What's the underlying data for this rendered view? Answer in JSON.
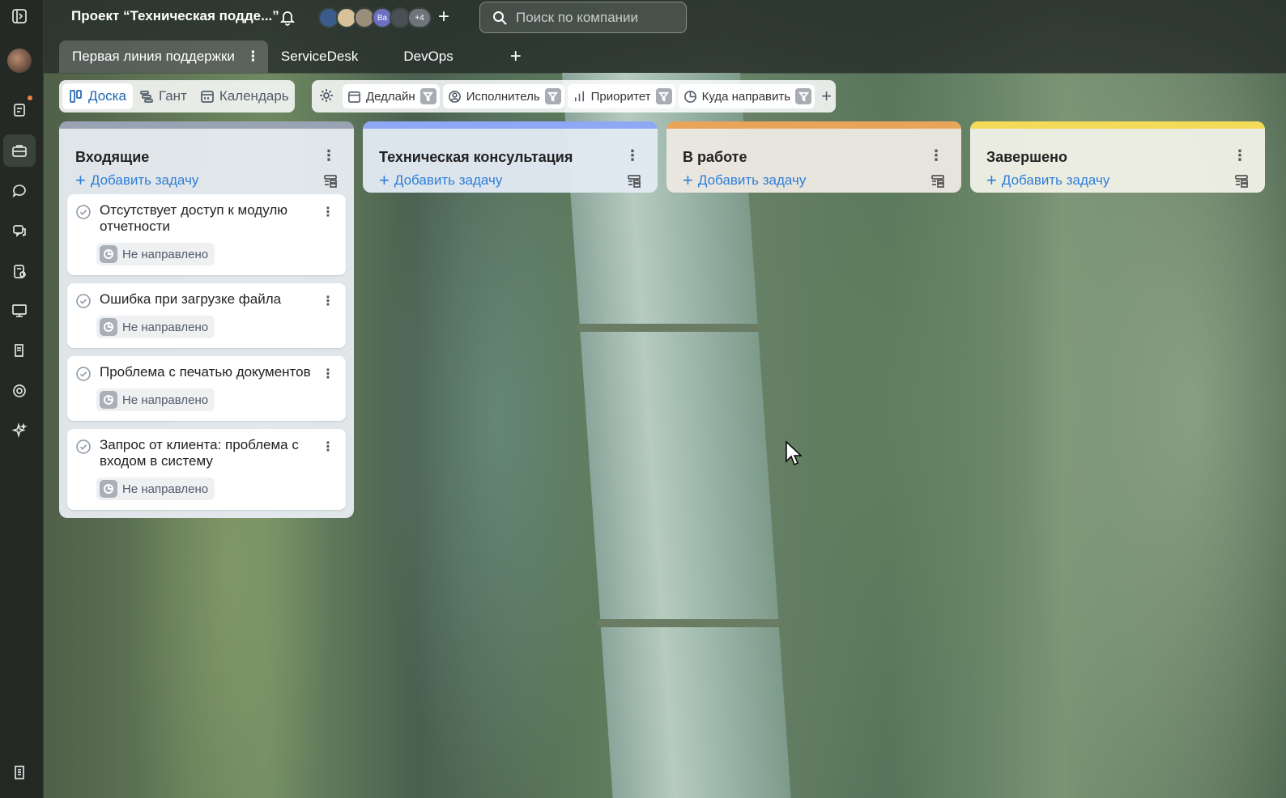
{
  "header": {
    "project_title": "Проект “Техническая подде...”",
    "members_more": "+4",
    "member_initials": "Ва",
    "search_placeholder": "Поиск по компании"
  },
  "tabs": [
    {
      "label": "Первая линия поддержки",
      "active": true
    },
    {
      "label": "ServiceDesk",
      "active": false
    },
    {
      "label": "DevOps",
      "active": false
    }
  ],
  "views": [
    {
      "label": "Доска",
      "icon": "board-icon",
      "active": true
    },
    {
      "label": "Гант",
      "icon": "gantt-icon",
      "active": false
    },
    {
      "label": "Календарь",
      "icon": "calendar-icon",
      "active": false
    }
  ],
  "filters": [
    {
      "label": "Дедлайн",
      "icon": "calendar-icon"
    },
    {
      "label": "Исполнитель",
      "icon": "user-icon"
    },
    {
      "label": "Приоритет",
      "icon": "bar-chart-icon"
    },
    {
      "label": "Куда направить",
      "icon": "pie-icon"
    }
  ],
  "columns": [
    {
      "title": "Входящие",
      "color": "#9aa3b4",
      "bg": "rgba(232,236,242,0.95)",
      "add_label": "Добавить задачу",
      "cards": [
        {
          "title": "Отсутствует доступ к модулю отчетности",
          "tag": "Не направлено"
        },
        {
          "title": "Ошибка при загрузке файла",
          "tag": "Не направлено"
        },
        {
          "title": "Проблема с печатью документов",
          "tag": "Не направлено"
        },
        {
          "title": "Запрос от клиента: проблема с входом в систему",
          "tag": "Не направлено"
        }
      ]
    },
    {
      "title": "Техническая консультация",
      "color": "#8fa8f5",
      "bg": "rgba(226,233,243,0.96)",
      "add_label": "Добавить задачу",
      "cards": []
    },
    {
      "title": "В работе",
      "color": "#e8a55a",
      "bg": "rgba(236,232,226,0.96)",
      "add_label": "Добавить задачу",
      "cards": []
    },
    {
      "title": "Завершено",
      "color": "#f3da58",
      "bg": "rgba(240,240,230,0.96)",
      "add_label": "Добавить задачу",
      "cards": []
    }
  ]
}
